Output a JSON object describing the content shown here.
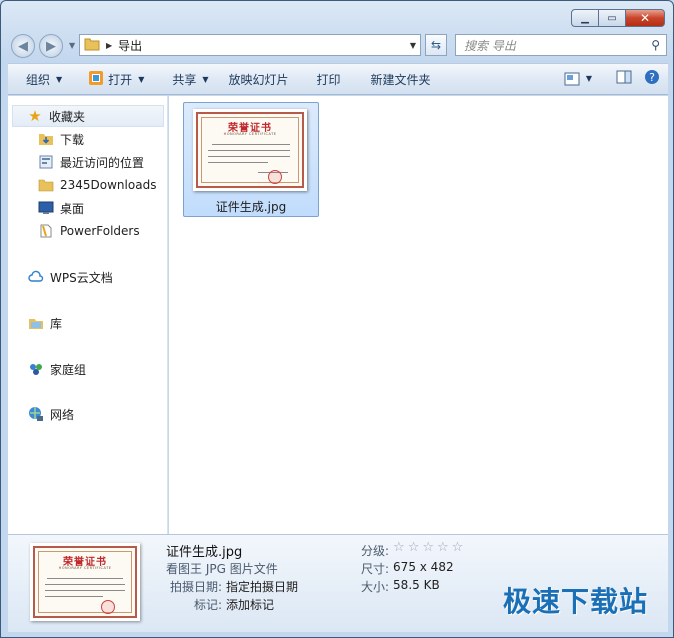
{
  "address": {
    "crumb": "导出",
    "search_placeholder": "搜索 导出"
  },
  "toolbar": {
    "organize": "组织",
    "open": "打开",
    "share": "共享",
    "slideshow": "放映幻灯片",
    "print": "打印",
    "new_folder": "新建文件夹"
  },
  "nav": {
    "favorites": "收藏夹",
    "downloads": "下载",
    "recent": "最近访问的位置",
    "downloads2345": "2345Downloads",
    "desktop": "桌面",
    "powerfolders": "PowerFolders",
    "wps": "WPS云文档",
    "library": "库",
    "homegroup": "家庭组",
    "network": "网络"
  },
  "file": {
    "name": "证件生成.jpg",
    "cert_title": "荣誉证书"
  },
  "details": {
    "name": "证件生成.jpg",
    "type": "看图王 JPG 图片文件",
    "taken_key": "拍摄日期:",
    "taken_val": "指定拍摄日期",
    "tags_key": "标记:",
    "tags_val": "添加标记",
    "rating_key": "分级:",
    "size_dim_key": "尺寸:",
    "size_dim_val": "675 x 482",
    "filesize_key": "大小:",
    "filesize_val": "58.5 KB",
    "rating_stars": 0
  },
  "watermark": "极速下载站",
  "icons": {
    "back": "back-arrow-icon",
    "forward": "forward-arrow-icon",
    "folder": "folder-icon",
    "refresh": "refresh-icon",
    "search": "search-icon"
  }
}
